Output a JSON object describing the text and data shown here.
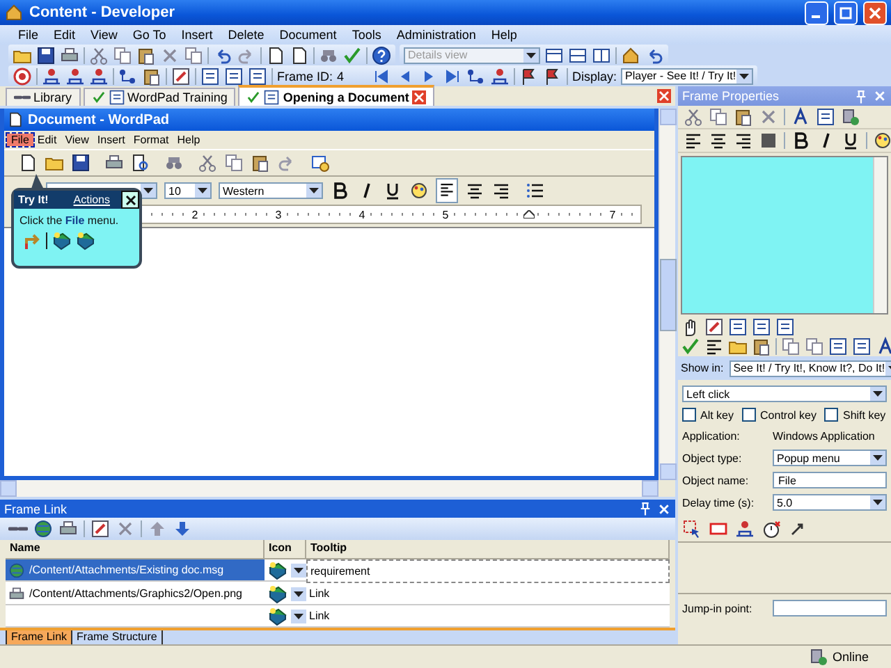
{
  "window": {
    "title": "Content - Developer"
  },
  "menu": [
    {
      "label": "File"
    },
    {
      "label": "Edit"
    },
    {
      "label": "View"
    },
    {
      "label": "Go To"
    },
    {
      "label": "Insert"
    },
    {
      "label": "Delete"
    },
    {
      "label": "Document"
    },
    {
      "label": "Tools"
    },
    {
      "label": "Administration"
    },
    {
      "label": "Help"
    }
  ],
  "toolbar": {
    "view_select": {
      "placeholder": "Details view",
      "disabled": true
    },
    "frame_id_label": "Frame ID:",
    "frame_id": "4",
    "display_label": "Display:",
    "display_value": "Player - See It! / Try It!"
  },
  "doc_tabs": [
    {
      "label": "Library",
      "selected": false
    },
    {
      "label": "WordPad Training",
      "selected": false
    },
    {
      "label": "Opening a Document",
      "selected": true
    }
  ],
  "wordpad": {
    "title": "Document - WordPad",
    "menu": [
      {
        "label": "File",
        "highlighted": true
      },
      {
        "label": "Edit",
        "highlighted": false
      },
      {
        "label": "View",
        "highlighted": false
      },
      {
        "label": "Insert",
        "highlighted": false
      },
      {
        "label": "Format",
        "highlighted": false
      },
      {
        "label": "Help",
        "highlighted": false
      }
    ],
    "font_size": "10",
    "script": "Western",
    "ruler_labels": [
      "2",
      "3",
      "4",
      "5"
    ],
    "ruler_labels_after_indent": [
      "7"
    ]
  },
  "bubble": {
    "title": "Try It!",
    "link": "Actions",
    "text": "Click the **File** menu."
  },
  "frame_link": {
    "title": "Frame Link",
    "columns": [
      "Name",
      "Icon",
      "Tooltip"
    ],
    "rows": [
      {
        "name": "/Content/Attachments/Existing doc.msg",
        "tooltip": "requirement",
        "selected": true,
        "kind": "message"
      },
      {
        "name": "/Content/Attachments/Graphics2/Open.png",
        "tooltip": "Link",
        "selected": false,
        "kind": "image"
      },
      {
        "tooltip": "Link",
        "selected": false,
        "kind": "empty"
      }
    ],
    "tabs": [
      {
        "label": "Frame Link",
        "selected": true
      },
      {
        "label": "Frame Structure",
        "selected": false
      }
    ]
  },
  "properties": {
    "title": "Frame Properties",
    "show_in_label": "Show in:",
    "show_in": "See It! / Try It!, Know It?, Do It!",
    "action": "Left click",
    "checkboxes": [
      {
        "label": "Alt key",
        "checked": false
      },
      {
        "label": "Control key",
        "checked": false
      },
      {
        "label": "Shift key",
        "checked": false
      }
    ],
    "application_label": "Application:",
    "application": "Windows Application",
    "object_type_label": "Object type:",
    "object_type": "Popup menu",
    "object_name_label": "Object name:",
    "object_name": "File",
    "delay_label": "Delay time (s):",
    "delay": "5.0",
    "jump_in_label": "Jump-in point:"
  },
  "status_bar": {
    "status": "Online"
  }
}
